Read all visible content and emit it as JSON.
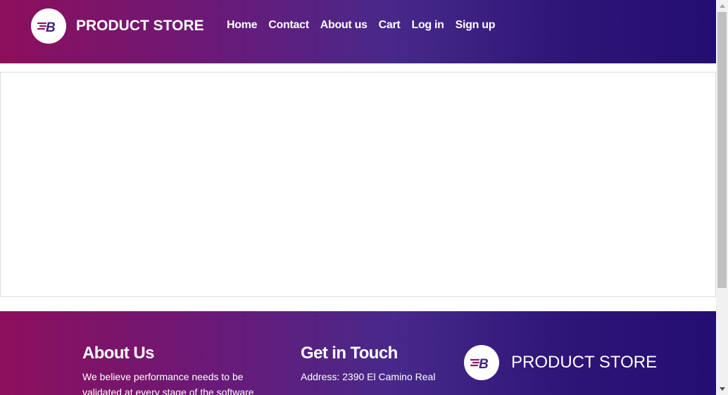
{
  "header": {
    "brand": "PRODUCT STORE",
    "logo_icon": "blazemeter-b-logo",
    "nav": [
      {
        "label": "Home"
      },
      {
        "label": "Contact"
      },
      {
        "label": "About us"
      },
      {
        "label": "Cart"
      },
      {
        "label": "Log in"
      },
      {
        "label": "Sign up"
      }
    ]
  },
  "footer": {
    "about": {
      "title": "About Us",
      "text_line1": "We believe performance needs to be",
      "text_line2": "validated at every stage of the software"
    },
    "contact": {
      "title": "Get in Touch",
      "address": "Address: 2390 El Camino Real"
    },
    "brand": "PRODUCT STORE"
  },
  "colors": {
    "gradient_start": "#8d0f5c",
    "gradient_end": "#240e72",
    "logo_letter": "#4a1f86"
  }
}
